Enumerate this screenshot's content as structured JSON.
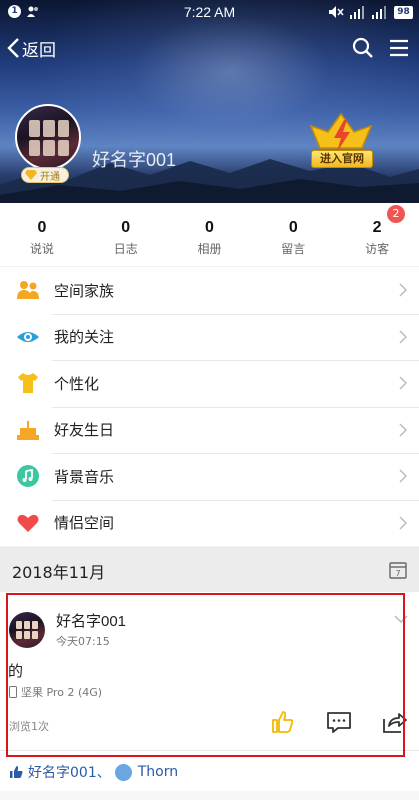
{
  "status_bar": {
    "notification_count": "1",
    "time": "7:22 AM",
    "battery": "98"
  },
  "nav": {
    "back_label": "返回"
  },
  "profile": {
    "username": "好名字001",
    "vip_label": "开通",
    "official_label": "进入官网"
  },
  "stats": [
    {
      "value": "0",
      "label": "说说"
    },
    {
      "value": "0",
      "label": "日志"
    },
    {
      "value": "0",
      "label": "相册"
    },
    {
      "value": "0",
      "label": "留言"
    },
    {
      "value": "2",
      "label": "访客"
    }
  ],
  "visitor_badge": "2",
  "menu": [
    {
      "label": "空间家族",
      "icon": "family-icon",
      "color": "#f5a623"
    },
    {
      "label": "我的关注",
      "icon": "eye-icon",
      "color": "#2a9fd8"
    },
    {
      "label": "个性化",
      "icon": "tshirt-icon",
      "color": "#f5c01a"
    },
    {
      "label": "好友生日",
      "icon": "cake-icon",
      "color": "#f5a623"
    },
    {
      "label": "背景音乐",
      "icon": "music-icon",
      "color": "#3cc7a0"
    },
    {
      "label": "情侣空间",
      "icon": "heart-icon",
      "color": "#f04a4a"
    }
  ],
  "date_header": "2018年11月",
  "calendar_day": "7",
  "post": {
    "author": "好名字001",
    "time": "今天07:15",
    "content": "的",
    "device": "坚果 Pro 2 (4G)",
    "views": "浏览1次"
  },
  "likes": {
    "first": "好名字001",
    "separator": "、",
    "second": "Thorn"
  },
  "colors": {
    "highlight": "#d9151c",
    "link": "#2a5aa8",
    "badge": "#f05555"
  }
}
